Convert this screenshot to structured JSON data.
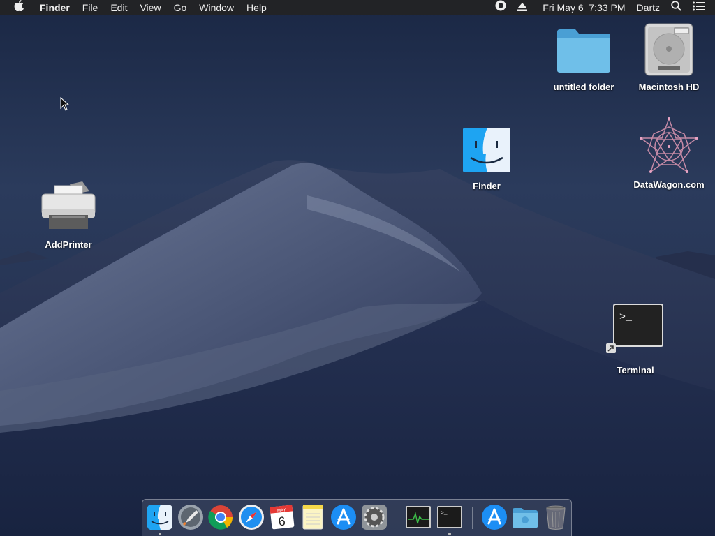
{
  "menubar": {
    "app_name": "Finder",
    "menus": [
      "File",
      "Edit",
      "View",
      "Go",
      "Window",
      "Help"
    ],
    "datetime": "Fri May 6  7:33 PM",
    "user": "Dartz",
    "icons": [
      "apple-icon",
      "record-icon",
      "eject-icon",
      "spotlight-search-icon",
      "notification-center-icon"
    ]
  },
  "desktop_icons": {
    "untitled_folder": "untitled folder",
    "macintosh_hd": "Macintosh HD",
    "finder": "Finder",
    "datawagon": "DataWagon.com",
    "addprinter": "AddPrinter",
    "terminal": "Terminal"
  },
  "dock": {
    "items": [
      "Finder",
      "Launchpad",
      "Google Chrome",
      "Safari",
      "Calendar",
      "Notes",
      "App Store",
      "System Preferences",
      "Activity Monitor",
      "Terminal",
      "App Store",
      "Folder",
      "Trash"
    ],
    "calendar_month": "MAY",
    "calendar_day": "6",
    "running": [
      "Finder",
      "Terminal"
    ]
  }
}
